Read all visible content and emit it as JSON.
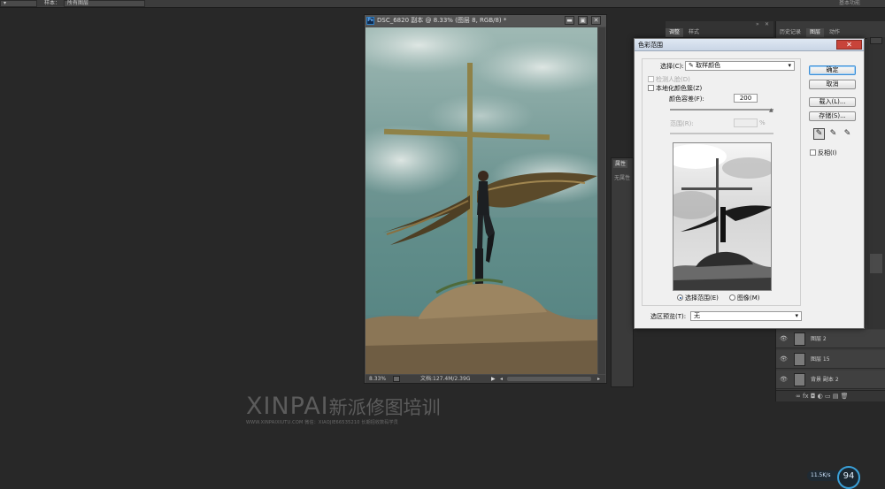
{
  "optionsbar": {
    "label_sample": "样本：",
    "sample_value": "所有图层",
    "top_right": "基本功能"
  },
  "document": {
    "title": "DSC_6820 副本 @ 8.33% (图层 8, RGB/8) *",
    "ps_badge": "Ps",
    "zoom": "8.33%",
    "doc_info": "文档:127.4M/2.39G",
    "buttons": {
      "minimize": "▬",
      "restore": "▣",
      "close": "✕"
    }
  },
  "dialog": {
    "title": "色彩范围",
    "close": "✕",
    "select_label": "选择(C):",
    "select_value": "取样颜色",
    "detect_faces": "检测人脸(D)",
    "localized": "本地化颜色簇(Z)",
    "fuzziness_label": "颜色容差(F):",
    "fuzziness_value": "200",
    "range_label": "范围(R):",
    "range_unit": "%",
    "preview_selection": "选择范围(E)",
    "preview_image": "图像(M)",
    "selection_preview_label": "选区预览(T):",
    "selection_preview_value": "无",
    "ok": "确定",
    "cancel": "取消",
    "load": "载入(L)...",
    "save": "存储(S)...",
    "invert": "反相(I)"
  },
  "panels": {
    "adjust_tab": "调整",
    "styles_tab": "样式",
    "history_tab": "历史记录",
    "layers_tab": "图层",
    "actions_tab": "动作",
    "properties_tab": "属性",
    "properties_empty": "无属性",
    "layer_peek": "3",
    "layers": [
      {
        "name": "图层 2"
      },
      {
        "name": "图层 15"
      },
      {
        "name": "背景 副本 2"
      }
    ],
    "footer_icons": "∞  fx  ◘  ◐  ▭  ▤  🗑"
  },
  "watermark": {
    "brand": "XINPAI",
    "brand_cn": "新派修图培训",
    "line": "WWW.XINPAIXIUTU.COM   微信：XIAOJIE66535210  长期招收数码学员"
  },
  "netmeter": {
    "speed": "11.5",
    "unit": "K/s",
    "percent": "94"
  },
  "colors": {
    "accent": "#3c8ed6",
    "close": "#c8443a"
  }
}
